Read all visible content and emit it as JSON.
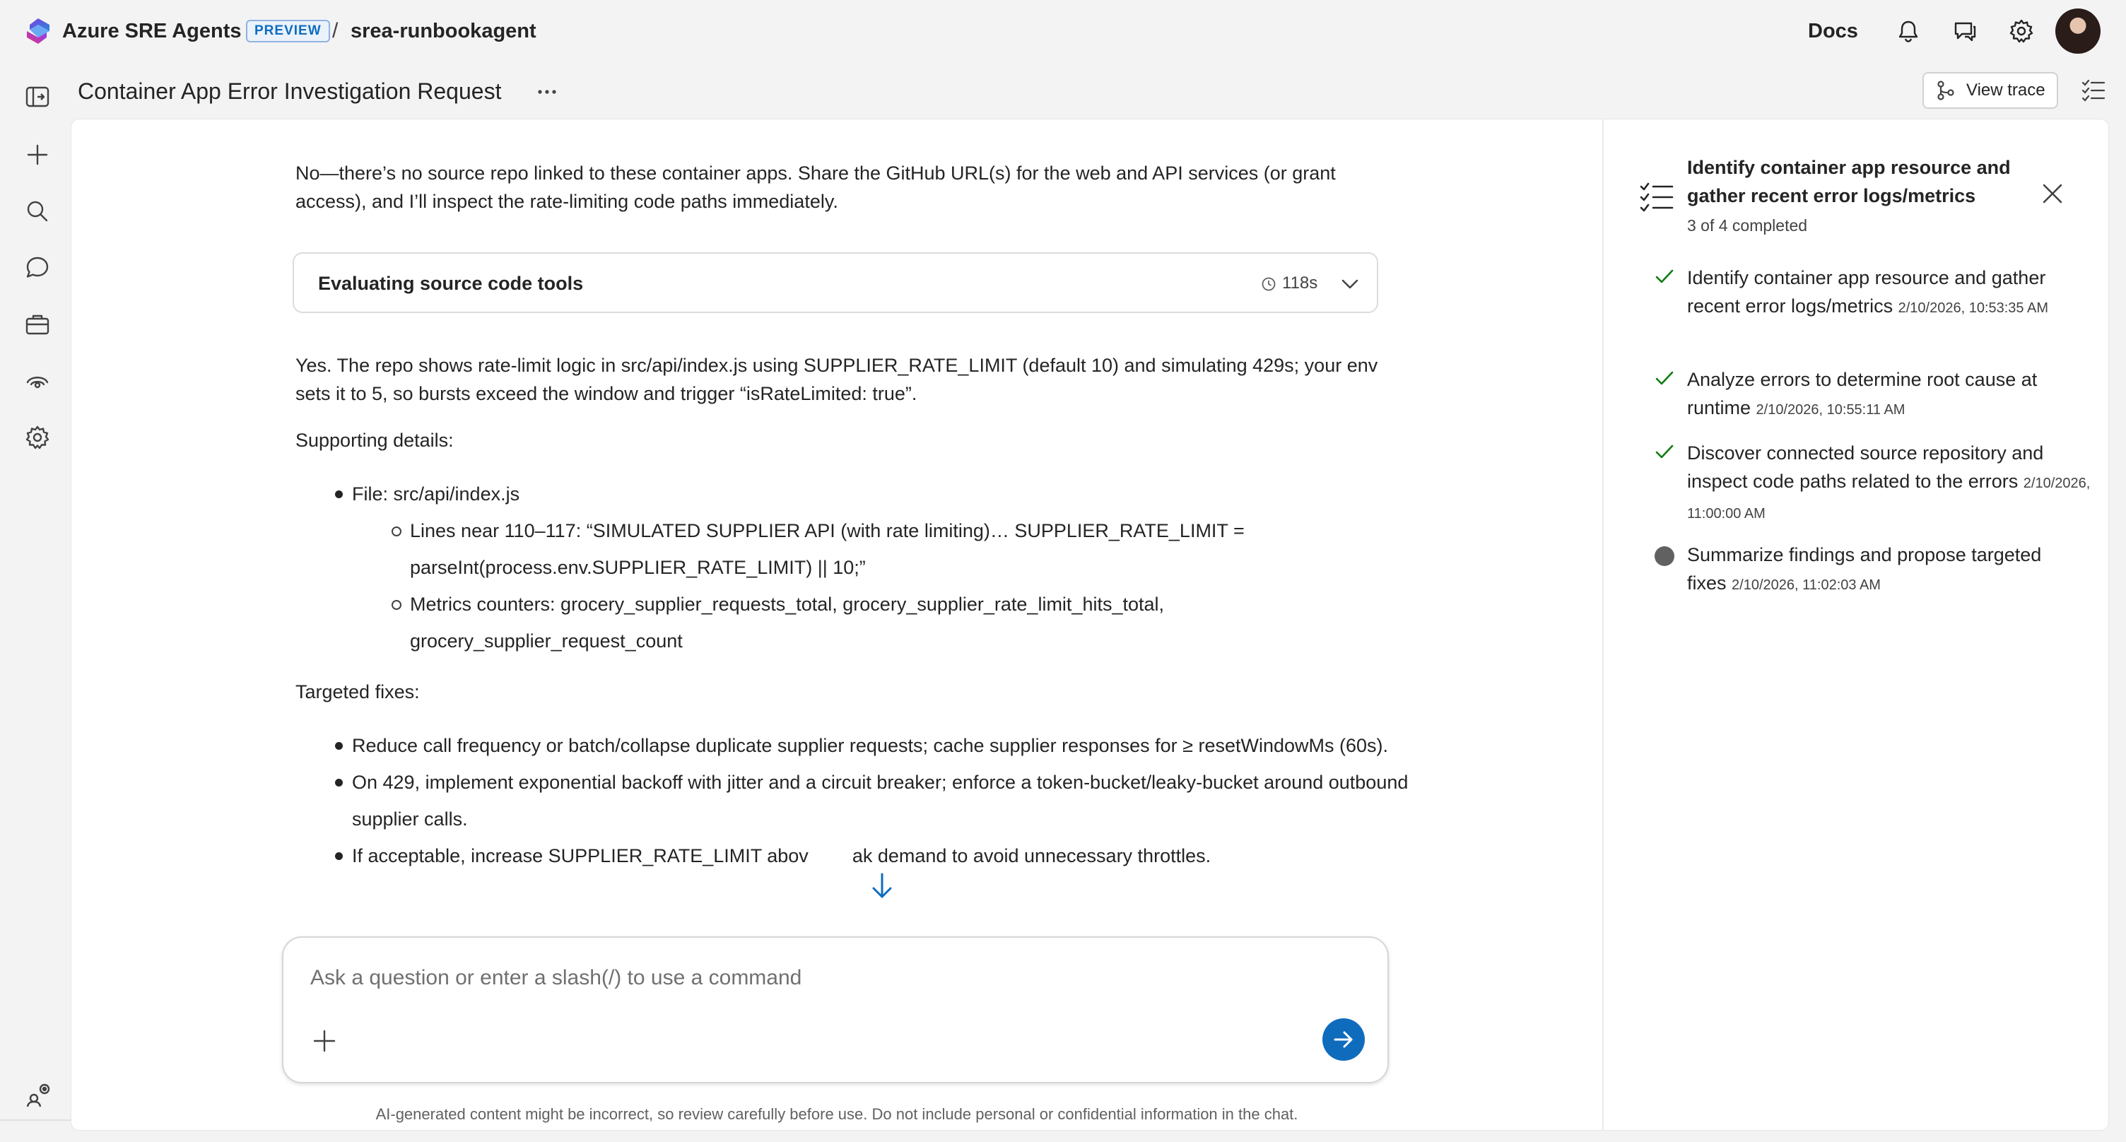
{
  "app": {
    "brand": "Azure SRE Agents",
    "badge": "PREVIEW",
    "separator": "/",
    "agent": "srea-runbookagent",
    "docs_label": "Docs",
    "accent_color": "#0f6cbd"
  },
  "header_icons": [
    "bell-icon",
    "feedback-icon",
    "gear-icon",
    "avatar"
  ],
  "rail_icons": [
    "sidebar-toggle-icon",
    "plus-icon",
    "search-icon",
    "chat-icon",
    "briefcase-icon",
    "monitor-icon",
    "settings-icon",
    "agents-icon"
  ],
  "thread": {
    "title": "Container App Error Investigation Request",
    "view_trace": "View trace"
  },
  "messages": {
    "intro": "No—there’s no source repo linked to these container apps. Share the GitHub URL(s) for the web and API services (or grant access), and I’ll inspect the rate-limiting code paths immediately.",
    "tool_card": {
      "label": "Evaluating source code tools",
      "duration": "118s"
    },
    "answer": "Yes. The repo shows rate-limit logic in src/api/index.js using SUPPLIER_RATE_LIMIT (default 10) and simulating 429s; your env sets it to 5, so bursts exceed the window and trigger “isRateLimited: true”.",
    "supporting_heading": "Supporting details:",
    "supporting": {
      "file": "File: src/api/index.js",
      "sub": [
        "Lines near 110–117: “SIMULATED SUPPLIER API (with rate limiting)… SUPPLIER_RATE_LIMIT = parseInt(process.env.SUPPLIER_RATE_LIMIT) || 10;”",
        "Metrics counters: grocery_supplier_requests_total, grocery_supplier_rate_limit_hits_total, grocery_supplier_request_count"
      ]
    },
    "fixes_heading": "Targeted fixes:",
    "fixes": [
      "Reduce call frequency or batch/collapse duplicate supplier requests; cache supplier responses for ≥ resetWindowMs (60s).",
      "On 429, implement exponential backoff with jitter and a circuit breaker; enforce a token-bucket/leaky-bucket around outbound supplier calls.",
      "If acceptable, increase SUPPLIER_RATE_LIMIT abov",
      "ak demand to avoid unnecessary throttles."
    ]
  },
  "composer": {
    "placeholder": "Ask a question or enter a slash(/) to use a command"
  },
  "disclaimer": "AI-generated content might be incorrect, so review carefully before use. Do not include personal or confidential information in the chat.",
  "task_pane": {
    "title": "Identify container app resource and gather recent error logs/metrics",
    "progress": "3 of 4 completed",
    "tasks": [
      {
        "text": "Identify container app resource and gather recent error logs/metrics",
        "time": "2/10/2026, 10:53:35 AM",
        "status": "completed"
      },
      {
        "text": "Analyze errors to determine root cause at runtime",
        "time": "2/10/2026, 10:55:11 AM",
        "status": "completed"
      },
      {
        "text": "Discover connected source repository and inspect code paths related to the errors",
        "time": "2/10/2026, 11:00:00 AM",
        "status": "completed"
      },
      {
        "text": "Summarize findings and propose targeted fixes",
        "time": "2/10/2026, 11:02:03 AM",
        "status": "in-progress"
      }
    ]
  }
}
